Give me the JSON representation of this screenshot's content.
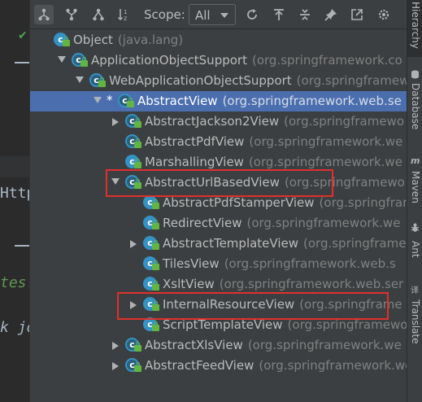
{
  "toolbar": {
    "buttons": [
      {
        "icon": "type-hierarchy-icon",
        "active": true
      },
      {
        "icon": "supertypes-hierarchy-icon"
      },
      {
        "icon": "subtypes-hierarchy-icon"
      },
      {
        "icon": "sort-alphabetically-icon"
      }
    ],
    "scope_label": "Scope:",
    "scope_value": "All",
    "actions": [
      "refresh-icon",
      "expand-all-icon",
      "collapse-all-icon",
      "pin-icon",
      "export-icon",
      "settings-icon"
    ]
  },
  "tree": {
    "rows": [
      {
        "name": "Object",
        "pkg": "(java.lang)",
        "depth": 0,
        "toggle": "none",
        "kind": "class"
      },
      {
        "name": "ApplicationObjectSupport",
        "pkg": "(org.springframework.co",
        "depth": 1,
        "toggle": "down",
        "kind": "abstract"
      },
      {
        "name": "WebApplicationObjectSupport",
        "pkg": "(org.springframew",
        "depth": 2,
        "toggle": "down",
        "kind": "abstract"
      },
      {
        "name": "AbstractView",
        "pkg": "(org.springframework.web.se",
        "depth": 3,
        "toggle": "down",
        "kind": "abstract",
        "star": "*",
        "selected": true
      },
      {
        "name": "AbstractJackson2View",
        "pkg": "(org.springframewo",
        "depth": 4,
        "toggle": "right",
        "kind": "abstract"
      },
      {
        "name": "AbstractPdfView",
        "pkg": "(org.springframework.we",
        "depth": 4,
        "toggle": "none",
        "kind": "abstract"
      },
      {
        "name": "MarshallingView",
        "pkg": "(org.springframework.we",
        "depth": 4,
        "toggle": "none",
        "kind": "class"
      },
      {
        "name": "AbstractUrlBasedView",
        "pkg": "(org.springframewo",
        "depth": 4,
        "toggle": "down",
        "kind": "abstract"
      },
      {
        "name": "AbstractPdfStamperView",
        "pkg": "(org.springframe",
        "depth": 5,
        "toggle": "none",
        "kind": "class"
      },
      {
        "name": "RedirectView",
        "pkg": "(org.springframework.we",
        "depth": 5,
        "toggle": "none",
        "kind": "class"
      },
      {
        "name": "AbstractTemplateView",
        "pkg": "(org.springframewo",
        "depth": 5,
        "toggle": "right",
        "kind": "class"
      },
      {
        "name": "TilesView",
        "pkg": "(org.springframework.web.s",
        "depth": 5,
        "toggle": "none",
        "kind": "class"
      },
      {
        "name": "XsltView",
        "pkg": "(org.springframework.web.ser",
        "depth": 5,
        "toggle": "none",
        "kind": "class"
      },
      {
        "name": "InternalResourceView",
        "pkg": "(org.springframe",
        "depth": 5,
        "toggle": "right",
        "kind": "class"
      },
      {
        "name": "ScriptTemplateView",
        "pkg": "(org.springframework.w",
        "depth": 5,
        "toggle": "none",
        "kind": "class"
      },
      {
        "name": "AbstractXlsView",
        "pkg": "(org.springframework.we",
        "depth": 4,
        "toggle": "right",
        "kind": "abstract"
      },
      {
        "name": "AbstractFeedView",
        "pkg": "(org.springframework.we",
        "depth": 4,
        "toggle": "right",
        "kind": "abstract"
      }
    ]
  },
  "highlights": [
    "AbstractUrlBasedView",
    "InternalResourceView"
  ],
  "editor": {
    "fragments": [
      "Http",
      "tes.",
      "k jo"
    ]
  },
  "rightbar": {
    "tabs": [
      {
        "label": "Hierarchy",
        "active": true,
        "icon": "hierarchy-icon"
      },
      {
        "label": "Database",
        "icon": "database-icon"
      },
      {
        "label": "Maven",
        "icon": "maven-icon"
      },
      {
        "label": "Ant",
        "icon": "ant-icon"
      },
      {
        "label": "Translate",
        "icon": "translate-icon"
      }
    ]
  },
  "colors": {
    "selection": "#4b6eaf",
    "highlight_box": "#e0302b",
    "class_icon": "#3592c4",
    "lock": "#62b543"
  }
}
